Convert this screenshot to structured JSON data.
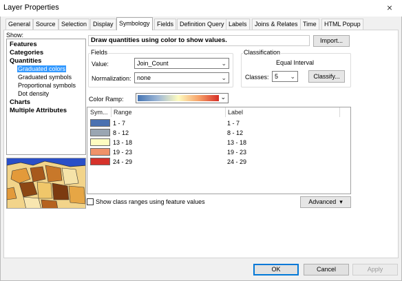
{
  "window": {
    "title": "Layer Properties",
    "close_glyph": "×"
  },
  "tabs": [
    {
      "label": "General",
      "active": false
    },
    {
      "label": "Source",
      "active": false
    },
    {
      "label": "Selection",
      "active": false
    },
    {
      "label": "Display",
      "active": false
    },
    {
      "label": "Symbology",
      "active": true
    },
    {
      "label": "Fields",
      "active": false
    },
    {
      "label": "Definition Query",
      "active": false
    },
    {
      "label": "Labels",
      "active": false
    },
    {
      "label": "Joins & Relates",
      "active": false
    },
    {
      "label": "Time",
      "active": false
    },
    {
      "label": "HTML Popup",
      "active": false
    }
  ],
  "show_panel": {
    "label": "Show:",
    "items": [
      {
        "label": "Features"
      },
      {
        "label": "Categories"
      },
      {
        "label": "Quantities"
      },
      {
        "label": "Graduated colors",
        "selected": true
      },
      {
        "label": "Graduated symbols"
      },
      {
        "label": "Proportional symbols"
      },
      {
        "label": "Dot density"
      },
      {
        "label": "Charts"
      },
      {
        "label": "Multiple Attributes"
      }
    ]
  },
  "description": "Draw quantities using color to show values.",
  "import_button": "Import...",
  "fields": {
    "group_label": "Fields",
    "value_label": "Value:",
    "value": "Join_Count",
    "normalization_label": "Normalization:",
    "normalization": "none"
  },
  "classification": {
    "group_label": "Classification",
    "method": "Equal Interval",
    "classes_label": "Classes:",
    "classes": "5",
    "classify_button": "Classify..."
  },
  "color_ramp": {
    "label": "Color Ramp:"
  },
  "table": {
    "headers": {
      "symbol": "Sym...",
      "range": "Range",
      "label": "Label"
    },
    "rows": [
      {
        "color": "#4a71b1",
        "range": "1 - 7",
        "label": "1 - 7"
      },
      {
        "color": "#9aa6b2",
        "range": "8 - 12",
        "label": "8 - 12"
      },
      {
        "color": "#fefcc0",
        "range": "13 - 18",
        "label": "13 - 18"
      },
      {
        "color": "#f09269",
        "range": "19 - 23",
        "label": "19 - 23"
      },
      {
        "color": "#d6322b",
        "range": "24 - 29",
        "label": "24 - 29"
      }
    ]
  },
  "show_ranges_checkbox": {
    "label": "Show class ranges using feature values",
    "checked": false
  },
  "advanced_button": "Advanced",
  "buttons": {
    "ok": "OK",
    "cancel": "Cancel",
    "apply": "Apply"
  }
}
